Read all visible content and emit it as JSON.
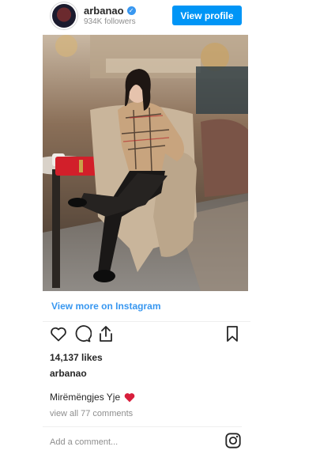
{
  "header": {
    "username": "arbanao",
    "followers": "934K followers",
    "view_profile_label": "View profile",
    "verified_icon": "verified-badge-icon"
  },
  "post": {
    "view_more_label": "View more on Instagram",
    "likes": "14,137 likes",
    "author": "arbanao",
    "caption": "Mirëmëngjes Yje",
    "caption_emoji": "red-heart-icon",
    "comments_link": "view all 77 comments",
    "comment_placeholder": "Add a comment..."
  },
  "icons": {
    "like": "heart-outline-icon",
    "comment": "comment-bubble-icon",
    "share": "share-icon",
    "save": "bookmark-icon",
    "brand": "instagram-logo-icon"
  },
  "colors": {
    "button_blue": "#0095f6",
    "link_blue": "#3897f0",
    "muted_text": "#8e8e8e",
    "heart_red": "#d81e3c"
  }
}
